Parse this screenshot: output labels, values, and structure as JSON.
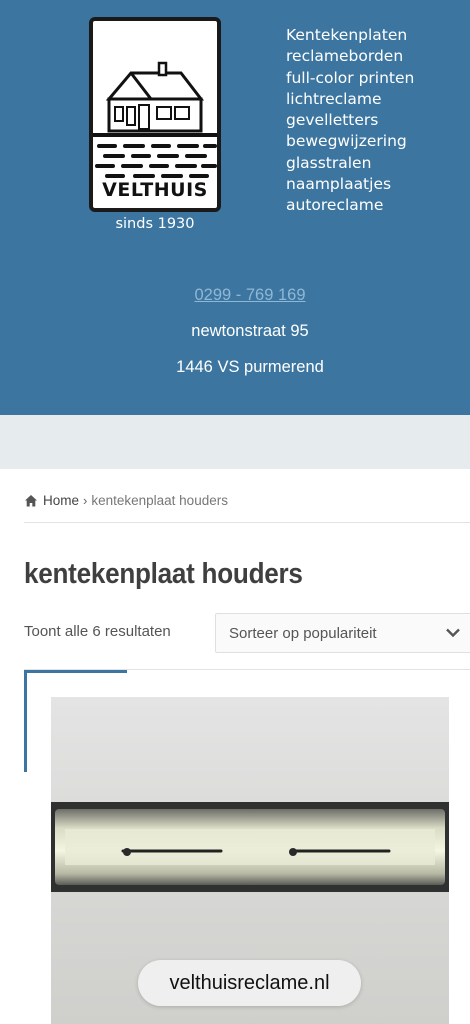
{
  "header": {
    "logo_word": "VELTHUIS",
    "logo_tagline": "sinds 1930",
    "services": [
      "Kentekenplaten",
      "reclameborden",
      "full-color printen",
      "lichtreclame",
      "gevelletters",
      "bewegwijzering",
      "glasstralen",
      "naamplaatjes",
      "autoreclame"
    ],
    "phone": "0299 - 769 169",
    "street": "newtonstraat 95",
    "city": "1446 VS purmerend",
    "background_color": "#3c76a0"
  },
  "breadcrumb": {
    "home_icon": "home-icon",
    "home_label": "Home",
    "separator": "›",
    "current": "kentekenplaat houders"
  },
  "main": {
    "title": "kentekenplaat houders",
    "result_count": "Toont alle 6 resultaten",
    "sort": {
      "selected": "Sorteer op populariteit",
      "icon": "chevron-down-icon"
    }
  },
  "browser": {
    "url": "velthuisreclame.nl"
  },
  "colors": {
    "accent": "#3c76a0",
    "band": "#e6ebee",
    "link_muted": "#8fb7d6"
  }
}
